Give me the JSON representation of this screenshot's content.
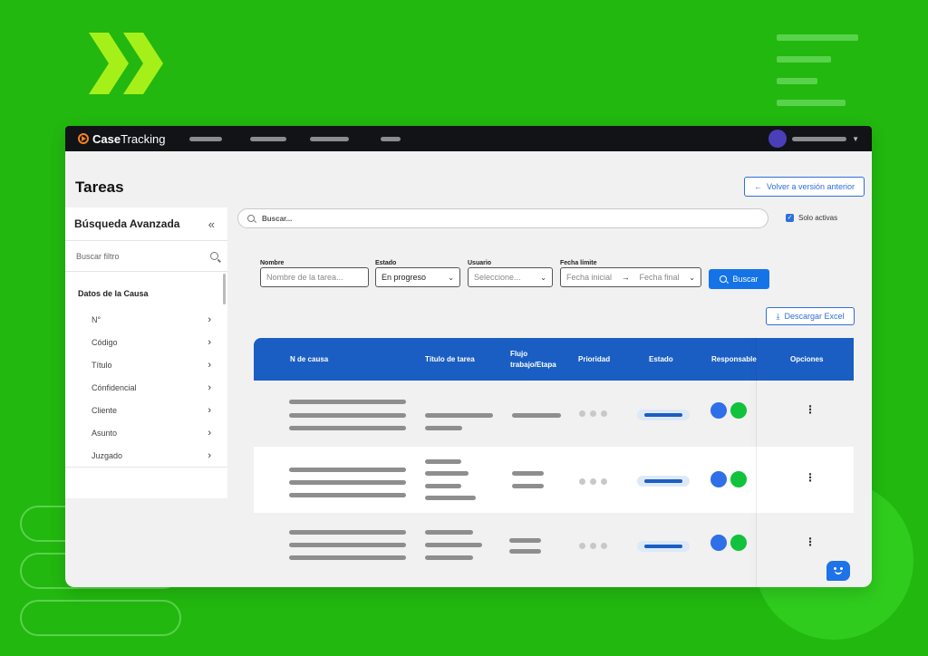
{
  "app": {
    "brand_bold": "Case",
    "brand_rest": "Tracking"
  },
  "page": {
    "title": "Tareas",
    "back_label": "Volver a versión anterior"
  },
  "sidebar": {
    "title": "Búsqueda Avanzada",
    "collapse_icon": "«",
    "search_placeholder": "Buscar filtro",
    "section": "Datos de la Causa",
    "items": [
      {
        "label": "N°"
      },
      {
        "label": "Código"
      },
      {
        "label": "Título"
      },
      {
        "label": "Cónfidencial"
      },
      {
        "label": "Cliente"
      },
      {
        "label": "Asunto"
      },
      {
        "label": "Juzgado"
      }
    ]
  },
  "search": {
    "placeholder": "Buscar...",
    "solo_activas": "Solo activas",
    "solo_checked": true
  },
  "filters": {
    "nombre": {
      "label": "Nombre",
      "placeholder": "Nombre de la tarea..."
    },
    "estado": {
      "label": "Estado",
      "value": "En progreso"
    },
    "usuario": {
      "label": "Usuario",
      "placeholder": "Seleccione..."
    },
    "fecha": {
      "label": "Fecha límite",
      "start": "Fecha inicial",
      "end": "Fecha final"
    },
    "buscar_label": "Buscar"
  },
  "excel_label": "Descargar Excel",
  "table": {
    "headers": {
      "causa": "N de causa",
      "titulo": "Título de tarea",
      "flujo": "Flujo trabajo/Etapa",
      "prioridad": "Prioridad",
      "estado": "Estado",
      "responsable": "Responsable",
      "opciones": "Opciones"
    },
    "rows": 3
  },
  "colors": {
    "background": "#22b80f",
    "accent": "#1b5ec3",
    "button": "#1573e8",
    "brand_orange": "#f58220",
    "responsable_blue": "#2f6fe8",
    "responsable_green": "#10c23c"
  }
}
